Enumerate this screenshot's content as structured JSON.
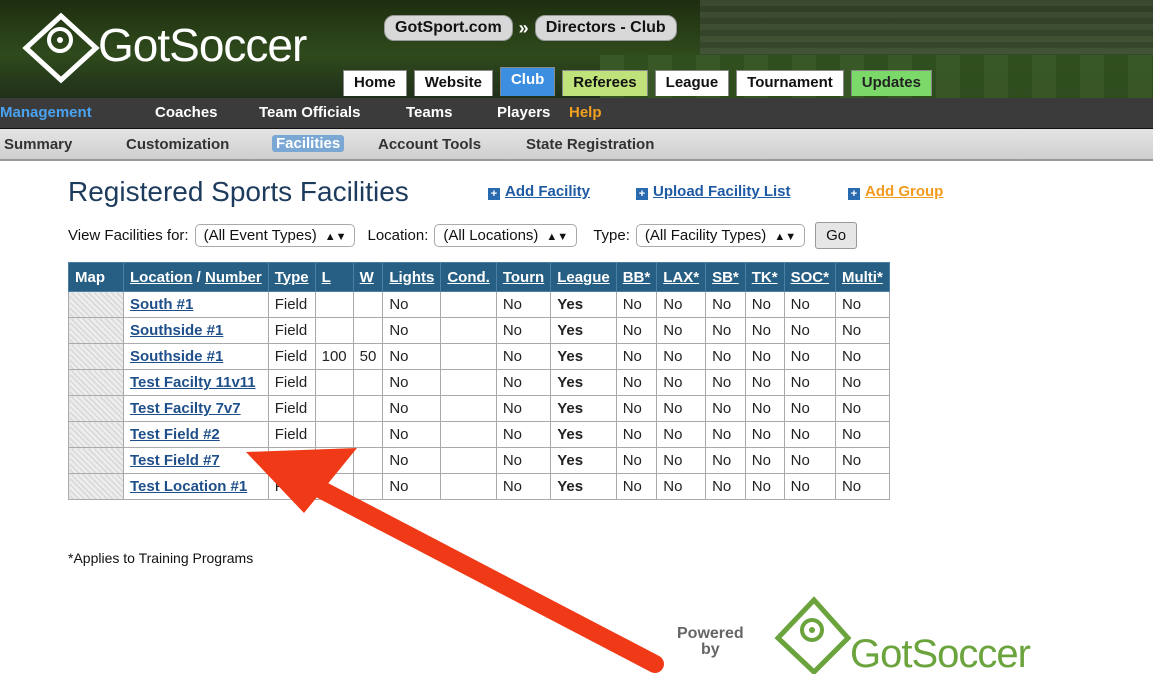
{
  "header": {
    "logo_text": "GotSoccer",
    "breadcrumb": [
      "GotSport.com",
      "Directors - Club"
    ],
    "breadcrumb_sep": "»",
    "tabs": [
      "Home",
      "Website",
      "Club",
      "Referees",
      "League",
      "Tournament",
      "Updates"
    ],
    "active_tab": "Club"
  },
  "nav": {
    "primary": [
      "Management",
      "Coaches",
      "Team Officials",
      "Teams",
      "Players",
      "Help"
    ],
    "secondary": [
      "Summary",
      "Customization",
      "Facilities",
      "Account Tools",
      "State Registration"
    ],
    "active_secondary": "Facilities"
  },
  "page": {
    "title": "Registered Sports Facilities",
    "actions": [
      "Add Facility",
      "Upload Facility List",
      "Add Group"
    ]
  },
  "filters": {
    "view_label": "View Facilities for:",
    "view_value": "(All Event Types)",
    "location_label": "Location:",
    "location_value": "(All Locations)",
    "type_label": "Type:",
    "type_value": "(All Facility Types)",
    "go_label": "Go"
  },
  "table": {
    "headers": [
      "Map",
      "Location",
      "/",
      "Number",
      "Type",
      "L",
      "W",
      "Lights",
      "Cond.",
      "Tourn",
      "League",
      "BB*",
      "LAX*",
      "SB*",
      "TK*",
      "SOC*",
      "Multi*"
    ],
    "rows": [
      {
        "location": "South #1",
        "type": "Field",
        "l": "",
        "w": "",
        "lights": "No",
        "cond": "",
        "tourn": "No",
        "league": "Yes",
        "bb": "No",
        "lax": "No",
        "sb": "No",
        "tk": "No",
        "soc": "No",
        "multi": "No"
      },
      {
        "location": "Southside #1",
        "type": "Field",
        "l": "",
        "w": "",
        "lights": "No",
        "cond": "",
        "tourn": "No",
        "league": "Yes",
        "bb": "No",
        "lax": "No",
        "sb": "No",
        "tk": "No",
        "soc": "No",
        "multi": "No"
      },
      {
        "location": "Southside #1",
        "type": "Field",
        "l": "100",
        "w": "50",
        "lights": "No",
        "cond": "",
        "tourn": "No",
        "league": "Yes",
        "bb": "No",
        "lax": "No",
        "sb": "No",
        "tk": "No",
        "soc": "No",
        "multi": "No"
      },
      {
        "location": "Test Facilty 11v11",
        "type": "Field",
        "l": "",
        "w": "",
        "lights": "No",
        "cond": "",
        "tourn": "No",
        "league": "Yes",
        "bb": "No",
        "lax": "No",
        "sb": "No",
        "tk": "No",
        "soc": "No",
        "multi": "No"
      },
      {
        "location": "Test Facilty 7v7",
        "type": "Field",
        "l": "",
        "w": "",
        "lights": "No",
        "cond": "",
        "tourn": "No",
        "league": "Yes",
        "bb": "No",
        "lax": "No",
        "sb": "No",
        "tk": "No",
        "soc": "No",
        "multi": "No"
      },
      {
        "location": "Test Field #2",
        "type": "Field",
        "l": "",
        "w": "",
        "lights": "No",
        "cond": "",
        "tourn": "No",
        "league": "Yes",
        "bb": "No",
        "lax": "No",
        "sb": "No",
        "tk": "No",
        "soc": "No",
        "multi": "No"
      },
      {
        "location": "Test Field #7",
        "type": "Field",
        "l": "",
        "w": "",
        "lights": "No",
        "cond": "",
        "tourn": "No",
        "league": "Yes",
        "bb": "No",
        "lax": "No",
        "sb": "No",
        "tk": "No",
        "soc": "No",
        "multi": "No"
      },
      {
        "location": "Test Location #1",
        "type": "Field",
        "l": "",
        "w": "",
        "lights": "No",
        "cond": "",
        "tourn": "No",
        "league": "Yes",
        "bb": "No",
        "lax": "No",
        "sb": "No",
        "tk": "No",
        "soc": "No",
        "multi": "No"
      }
    ]
  },
  "footnote": "*Applies to Training Programs",
  "footer": {
    "powered_line1": "Powered",
    "powered_line2": "by",
    "logo_text": "GotSoccer"
  },
  "colors": {
    "annotation_arrow": "#f03a17",
    "header_bar": "#275f84",
    "link": "#1f4f8a",
    "yes": "#2a5fc0",
    "brand_green": "#6ba33d"
  }
}
